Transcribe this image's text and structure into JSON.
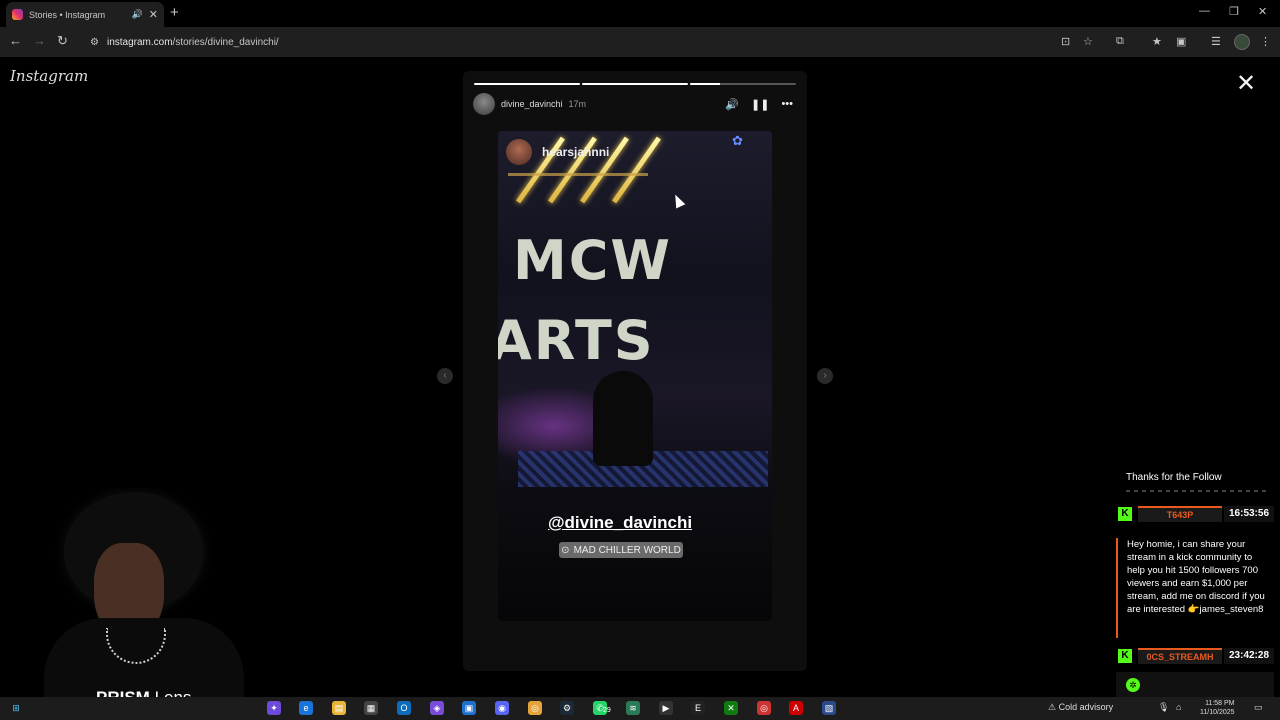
{
  "browser": {
    "tab_title": "Stories • Instagram",
    "url_host": "instagram.com",
    "url_path": "/stories/divine_davinchi/"
  },
  "instagram": {
    "logo": "Instagram",
    "story": {
      "username": "divine_davinchi",
      "time_ago": "17m",
      "progress": [
        1,
        1,
        0.28
      ],
      "mention": "hearsjahnni",
      "sign_line1": "MCW",
      "sign_line2": "ARTS",
      "tag": "@divine_davinchi",
      "location": "MAD CHILLER WORLD"
    }
  },
  "chat": {
    "header": "Thanks for the Follow",
    "messages": [
      {
        "user": "T643P",
        "time": "16:53:56",
        "text": "Hey homie, i can share your stream in a kick community to help you hit 1500 followers 700 viewers and earn $1,000 per stream, add me on discord if you are interested 👉james_steven8"
      },
      {
        "user": "0CS_STREAMH",
        "time": "23:42:28",
        "text": ""
      }
    ]
  },
  "webcam": {
    "brand_bold": "PRISM",
    "brand_rest": " Lens"
  },
  "taskbar": {
    "weather": "Cold advisory",
    "time": "11:58 PM",
    "date": "11/10/2025",
    "badge": "29"
  },
  "colors": {
    "kick_green": "#53fc18",
    "chat_accent": "#e85a1e"
  }
}
